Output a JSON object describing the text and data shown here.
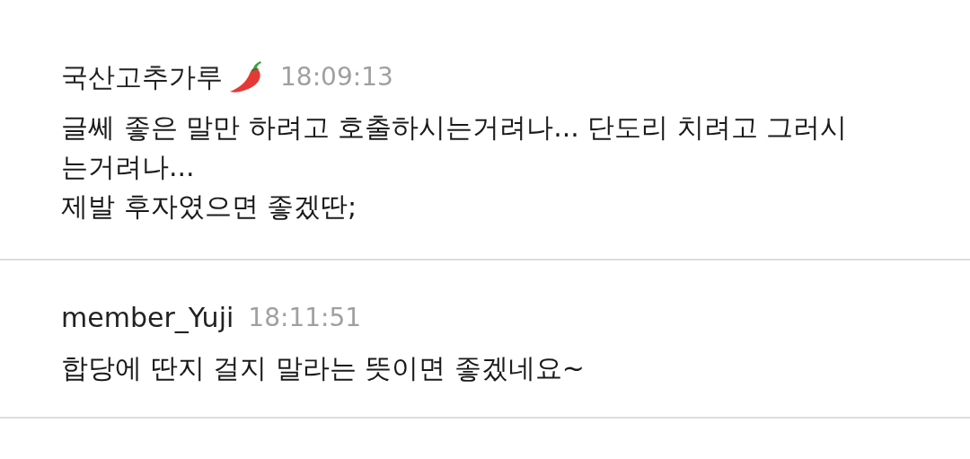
{
  "comments": [
    {
      "author": "국산고추가루",
      "author_badge": true,
      "time": "18:09:13",
      "body": "글쎄 좋은 말만 하려고 호출하시는거려나... 단도리 치려고 그러시는거려나...\n제발 후자였으면 좋겠딴;"
    },
    {
      "author": "member_Yuji",
      "author_badge": false,
      "time": "18:11:51",
      "body": "합당에 딴지 걸지 말라는 뜻이면 좋겠네요~"
    }
  ]
}
